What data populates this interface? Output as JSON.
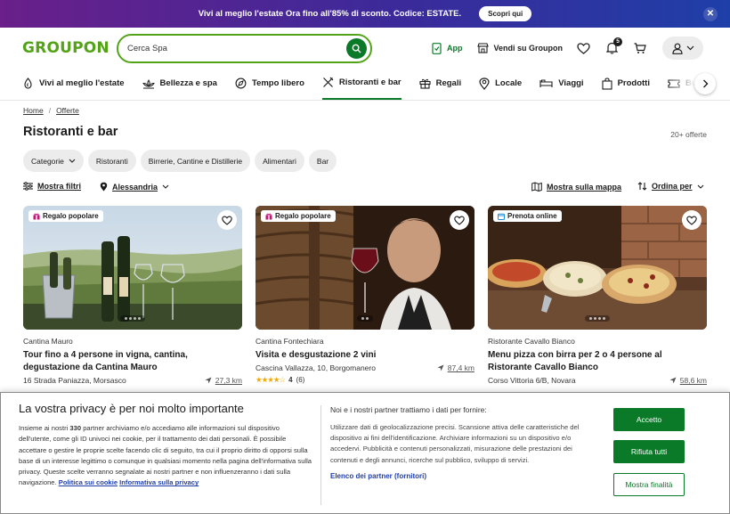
{
  "promo": {
    "text": "Vivi al meglio l'estate Ora fino all'85% di sconto. Codice: ESTATE.",
    "cta": "Scopri qui"
  },
  "header": {
    "logo": "GROUPON",
    "search_value": "Cerca Spa",
    "app_label": "App",
    "sell_label": "Vendi su Groupon",
    "notification_count": "5"
  },
  "categories": [
    {
      "label": "Vivi al meglio l'estate",
      "icon": "sun-icon"
    },
    {
      "label": "Bellezza e spa",
      "icon": "lotus-icon"
    },
    {
      "label": "Tempo libero",
      "icon": "compass-icon"
    },
    {
      "label": "Ristoranti e bar",
      "icon": "cutlery-icon",
      "active": true
    },
    {
      "label": "Regali",
      "icon": "gift-icon"
    },
    {
      "label": "Locale",
      "icon": "pin-icon"
    },
    {
      "label": "Viaggi",
      "icon": "bed-icon"
    },
    {
      "label": "Prodotti",
      "icon": "bag-icon"
    },
    {
      "label": "Bu",
      "icon": "ticket-icon"
    }
  ],
  "breadcrumb": {
    "home": "Home",
    "current": "Offerte"
  },
  "page": {
    "title": "Ristoranti e bar",
    "count": "20+ offerte"
  },
  "chips": [
    "Categorie",
    "Ristoranti",
    "Birrerie, Cantine e Distillerie",
    "Alimentari",
    "Bar"
  ],
  "toolbar": {
    "filters": "Mostra filtri",
    "location": "Alessandria",
    "map": "Mostra sulla mappa",
    "sort": "Ordina per"
  },
  "cards": [
    {
      "badge": "Regalo popolare",
      "merchant": "Cantina Mauro",
      "title": "Tour fino a 4 persone in vigna, cantina, degustazione da Cantina Mauro",
      "address": "16 Strada Paniazza, Morsasco",
      "distance": "27,3 km"
    },
    {
      "badge": "Regalo popolare",
      "merchant": "Cantina Fontechiara",
      "title": "Visita e desgustazione 2 vini",
      "address": "Cascina Vallazza, 10, Borgomanero",
      "distance": "87,4 km",
      "rating": "4",
      "reviews": "(6)",
      "stars": 4
    },
    {
      "badge": "Prenota online",
      "merchant": "Ristorante Cavallo Bianco",
      "title": "Menu pizza con birra per 2 o 4 persone al Ristorante Cavallo Bianco",
      "address": "Corso Vittoria 6/B, Novara",
      "distance": "58,6 km"
    }
  ],
  "privacy": {
    "title": "La vostra privacy è per noi molto importante",
    "body_pre": "Insieme ai nostri ",
    "body_count": "330",
    "body_post": " partner archiviamo e/o accediamo alle informazioni sul dispositivo dell'utente, come gli ID univoci nei cookie, per il trattamento dei dati personali. È possibile accettare o gestire le proprie scelte facendo clic di seguito, tra cui il proprio diritto di opporsi sulla base di un interesse legittimo o comunque in qualsiasi momento nella pagina dell'informativa sulla privacy. Queste scelte verranno segnalate ai nostri partner e non influenzeranno i dati sulla navigazione.",
    "cookie_link": "Politica sui cookie",
    "privacy_link": "Informativa sulla privacy",
    "partners_head": "Noi e i nostri partner trattiamo i dati per fornire:",
    "partners_text": "Utilizzare dati di geolocalizzazione precisi. Scansione attiva delle caratteristiche del dispositivo ai fini dell'identificazione. Archiviare informazioni su un dispositivo e/o accedervi. Pubblicità e contenuti personalizzati, misurazione delle prestazioni dei contenuti e degli annunci, ricerche sul pubblico, sviluppo di servizi.",
    "partners_link": "Elenco dei partner (fornitori)",
    "accept": "Accetto",
    "reject": "Rifiuta tutti",
    "settings": "Mostra finalità"
  },
  "colors": {
    "brand": "#53a318",
    "primary_green": "#0a7a28",
    "link_blue": "#1f3fa8"
  }
}
